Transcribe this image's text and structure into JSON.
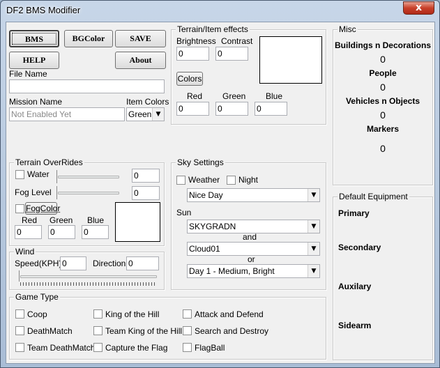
{
  "window": {
    "title": "DF2 BMS Modifier",
    "close_glyph": "x"
  },
  "toolbar": {
    "bms": "BMS",
    "bgcolor": "BGColor",
    "save": "SAVE",
    "help": "HELP",
    "about": "About"
  },
  "file": {
    "label": "File Name",
    "value": ""
  },
  "mission": {
    "label": "Mission Name",
    "value": "Not Enabled Yet",
    "item_colors_label": "Item Colors",
    "item_color": "Green"
  },
  "terrain_effects": {
    "title": "Terrain/Item effects",
    "brightness_label": "Brightness",
    "brightness": "0",
    "contrast_label": "Contrast",
    "contrast": "0",
    "colors_button": "Colors",
    "red_label": "Red",
    "red": "0",
    "green_label": "Green",
    "green": "0",
    "blue_label": "Blue",
    "blue": "0"
  },
  "misc": {
    "title": "Misc",
    "buildings_label": "Buildings n Decorations",
    "buildings": "0",
    "people_label": "People",
    "people": "0",
    "vehicles_label": "Vehicles n Objects",
    "vehicles": "0",
    "markers_label": "Markers",
    "markers": "0"
  },
  "terrain_overrides": {
    "title": "Terrain OverRides",
    "water_label": "Water",
    "water": "0",
    "fog_level_label": "Fog Level",
    "fog_level": "0",
    "fog_color_button": "FogColor",
    "red_label": "Red",
    "red": "0",
    "green_label": "Green",
    "green": "0",
    "blue_label": "Blue",
    "blue": "0"
  },
  "sky": {
    "title": "Sky Settings",
    "weather_label": "Weather",
    "night_label": "Night",
    "sky_preset": "Nice Day",
    "sun_label": "Sun",
    "sun_texture": "SKYGRADN",
    "and_label": "and",
    "cloud": "Cloud01",
    "or_label": "or",
    "time_preset": "Day 1 - Medium, Bright"
  },
  "wind": {
    "title": "Wind",
    "speed_label": "Speed(KPH)",
    "speed": "0",
    "direction_label": "Direction",
    "direction": "0"
  },
  "default_equipment": {
    "title": "Default Equipment",
    "primary": "Primary",
    "secondary": "Secondary",
    "auxilary": "Auxilary",
    "sidearm": "Sidearm"
  },
  "game_type": {
    "title": "Game Type",
    "options": [
      "Coop",
      "DeathMatch",
      "Team DeathMatch",
      "King of the Hill",
      "Team King of the Hill",
      "Capture the Flag",
      "Attack and Defend",
      "Search and Destroy",
      "FlagBall"
    ]
  }
}
